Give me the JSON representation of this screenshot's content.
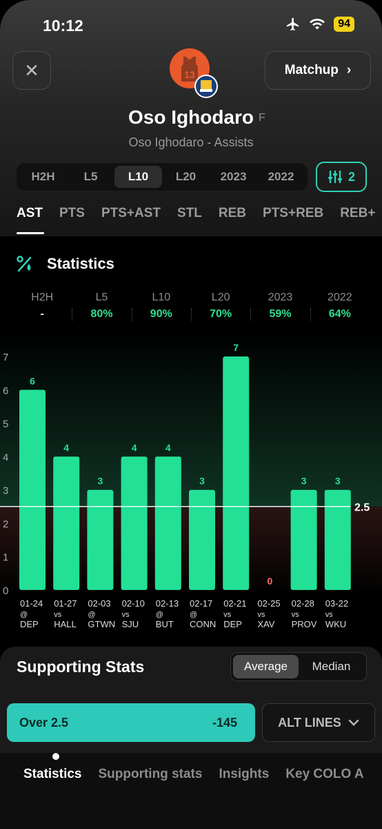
{
  "status": {
    "time": "10:12",
    "battery": "94"
  },
  "header": {
    "close_icon": "close-icon",
    "matchup_label": "Matchup",
    "player_name": "Oso Ighodaro",
    "position": "F",
    "subtitle": "Oso Ighodaro - Assists",
    "jersey_number": "13"
  },
  "ranges": [
    "H2H",
    "L5",
    "L10",
    "L20",
    "2023",
    "2022"
  ],
  "active_range": "L10",
  "filter_count": "2",
  "stat_tabs": [
    "AST",
    "PTS",
    "PTS+AST",
    "STL",
    "REB",
    "PTS+REB",
    "REB+"
  ],
  "active_stat_tab": "AST",
  "statistics": {
    "title": "Statistics",
    "summary": [
      {
        "label": "H2H",
        "value": "-"
      },
      {
        "label": "L5",
        "value": "80%"
      },
      {
        "label": "L10",
        "value": "90%"
      },
      {
        "label": "L20",
        "value": "70%"
      },
      {
        "label": "2023",
        "value": "59%"
      },
      {
        "label": "2022",
        "value": "64%"
      }
    ]
  },
  "chart_data": {
    "type": "bar",
    "ylim": [
      0,
      7
    ],
    "yticks": [
      0,
      1,
      2,
      3,
      4,
      5,
      6,
      7
    ],
    "line": 2.5,
    "line_label": "2.5",
    "categories": [
      {
        "date": "01-24",
        "loc": "@",
        "opp": "DEP"
      },
      {
        "date": "01-27",
        "loc": "vs",
        "opp": "HALL"
      },
      {
        "date": "02-03",
        "loc": "@",
        "opp": "GTWN"
      },
      {
        "date": "02-10",
        "loc": "vs",
        "opp": "SJU"
      },
      {
        "date": "02-13",
        "loc": "@",
        "opp": "BUT"
      },
      {
        "date": "02-17",
        "loc": "@",
        "opp": "CONN"
      },
      {
        "date": "02-21",
        "loc": "vs",
        "opp": "DEP"
      },
      {
        "date": "02-25",
        "loc": "vs",
        "opp": "XAV"
      },
      {
        "date": "02-28",
        "loc": "vs",
        "opp": "PROV"
      },
      {
        "date": "03-22",
        "loc": "vs",
        "opp": "WKU"
      }
    ],
    "values": [
      6,
      4,
      3,
      4,
      4,
      3,
      7,
      0,
      3,
      3
    ],
    "colors": {
      "over": "#22e096",
      "under": "#ff6b6b"
    }
  },
  "supporting": {
    "title": "Supporting Stats",
    "options": [
      "Average",
      "Median"
    ],
    "active": "Average",
    "over_label": "Over 2.5",
    "over_odds": "-145",
    "alt_lines": "ALT LINES"
  },
  "bottom_nav": [
    "Statistics",
    "Supporting stats",
    "Insights",
    "Key COLO A"
  ],
  "active_nav": "Statistics"
}
